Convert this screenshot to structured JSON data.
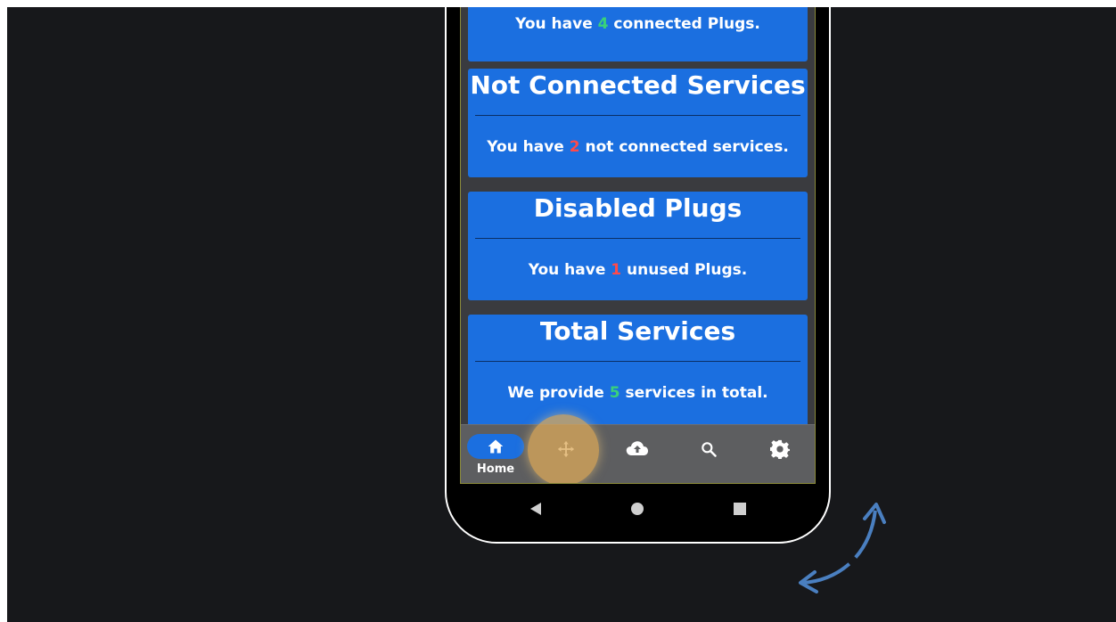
{
  "cards": [
    {
      "title": "",
      "text_before": "You have ",
      "number": "4",
      "text_after": " connected Plugs.",
      "number_color": "#39d17a"
    },
    {
      "title": "Not Connected Services",
      "text_before": "You have ",
      "number": "2",
      "text_after": " not connected services.",
      "number_color": "#ff4a4a"
    },
    {
      "title": "Disabled Plugs",
      "text_before": "You have ",
      "number": "1",
      "text_after": " unused Plugs.",
      "number_color": "#ff4a4a"
    },
    {
      "title": "Total Services",
      "text_before": "We provide ",
      "number": "5",
      "text_after": " services in total.",
      "number_color": "#39d17a"
    }
  ],
  "navbar": {
    "home_label": "Home",
    "items": [
      {
        "icon": "home-icon",
        "active": true
      },
      {
        "icon": "plugs-move-icon",
        "active": false
      },
      {
        "icon": "cloud-upload-icon",
        "active": false
      },
      {
        "icon": "search-icon",
        "active": false
      },
      {
        "icon": "gear-icon",
        "active": false
      }
    ]
  },
  "system_nav": {
    "icons": [
      "back-triangle-icon",
      "home-circle-icon",
      "recents-square-icon"
    ]
  },
  "colors": {
    "background": "#17181b",
    "card_blue": "#1b6fe0",
    "navbar_gray": "#5d5e60",
    "tap_highlight": "#dcaa5a",
    "arrow_blue": "#4a7fc0"
  }
}
